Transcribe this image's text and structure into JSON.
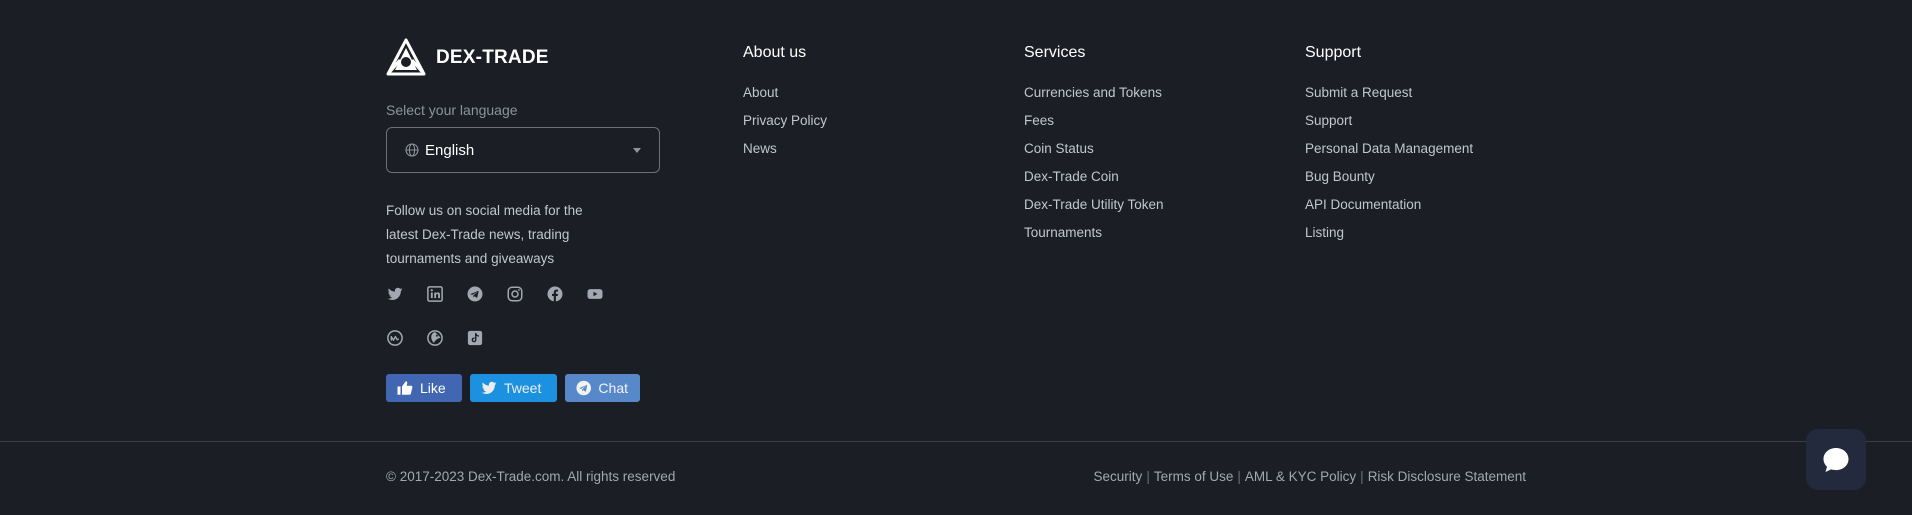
{
  "brand": {
    "name": "DEX-TRADE"
  },
  "language": {
    "label": "Select your language",
    "selected": "English"
  },
  "follow_text": "Follow us on social media for the latest Dex-Trade news, trading tournaments and giveaways",
  "social_icons": {
    "row1": [
      "twitter-icon",
      "linkedin-icon",
      "telegram-icon",
      "instagram-icon",
      "facebook-icon",
      "youtube-icon"
    ],
    "row2": [
      "coinmarketcap-icon",
      "coingecko-icon",
      "tiktok-icon"
    ]
  },
  "share": {
    "like": "Like",
    "tweet": "Tweet",
    "chat": "Chat"
  },
  "columns": {
    "about": {
      "title": "About us",
      "links": [
        "About",
        "Privacy Policy",
        "News"
      ]
    },
    "services": {
      "title": "Services",
      "links": [
        "Currencies and Tokens",
        "Fees",
        "Coin Status",
        "Dex-Trade Coin",
        "Dex-Trade Utility Token",
        "Tournaments"
      ]
    },
    "support": {
      "title": "Support",
      "links": [
        "Submit a Request",
        "Support",
        "Personal Data Management",
        "Bug Bounty",
        "API Documentation",
        "Listing"
      ]
    }
  },
  "bottom": {
    "copyright": "© 2017-2023 Dex-Trade.com. All rights reserved",
    "legal": [
      "Security",
      "Terms of Use",
      "AML & KYC Policy",
      "Risk Disclosure Statement"
    ],
    "separator": "|"
  },
  "colors": {
    "background": "#1b1e24",
    "like": "#4267b2",
    "tweet": "#1d9bf0",
    "chat": "#5b8ed2",
    "chat_fab": "#232a3d"
  }
}
